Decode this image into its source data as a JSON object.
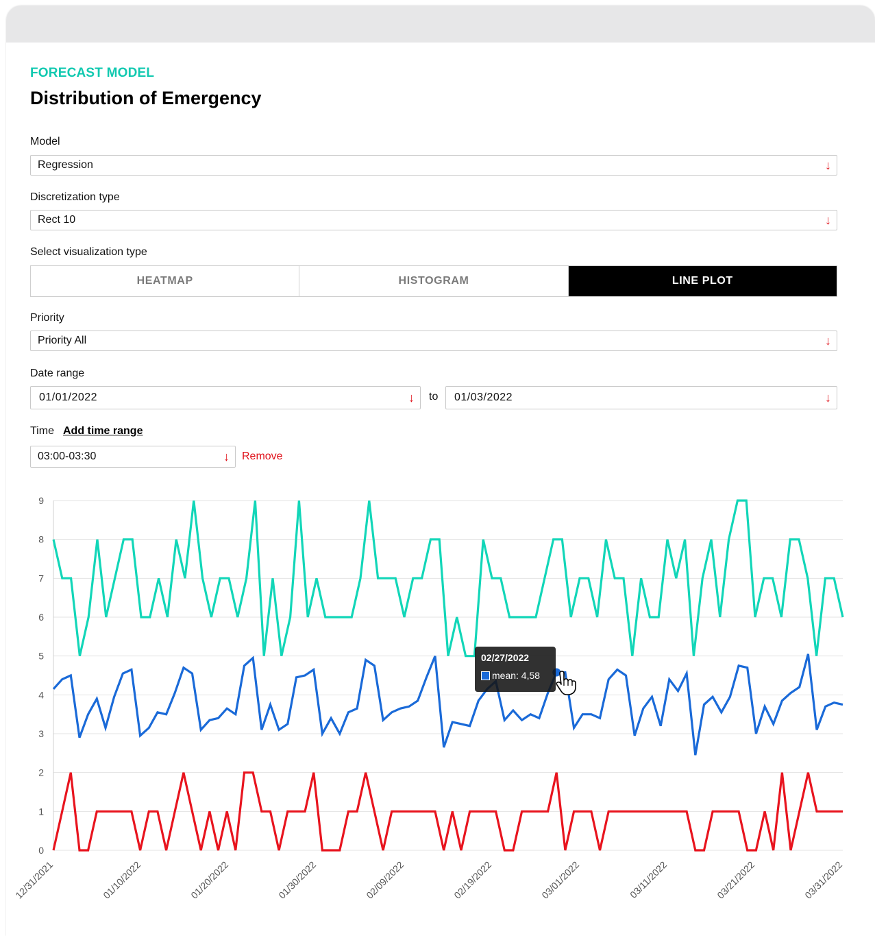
{
  "header": {
    "eyebrow": "FORECAST MODEL",
    "title": "Distribution of Emergency"
  },
  "form": {
    "model_label": "Model",
    "model_value": "Regression",
    "discretization_label": "Discretization type",
    "discretization_value": "Rect 10",
    "viz_label": "Select visualization type",
    "viz_options": [
      "HEATMAP",
      "HISTOGRAM",
      "LINE PLOT"
    ],
    "viz_selected": "LINE PLOT",
    "priority_label": "Priority",
    "priority_value": "Priority All",
    "date_label": "Date range",
    "date_from": "01/01/2022",
    "date_to_label": "to",
    "date_to": "01/03/2022",
    "time_label": "Time",
    "add_time_range": "Add time range",
    "time_value": "03:00-03:30",
    "remove_label": "Remove"
  },
  "icons": {
    "dropdown": "arrow-down-icon",
    "cursor": "hand-pointer-icon"
  },
  "colors": {
    "accent": "#12c9b0",
    "danger": "#e0121b",
    "series_top": "#12d6b8",
    "series_mean": "#1a6ad8",
    "series_bottom": "#e8141e"
  },
  "tooltip": {
    "date": "02/27/2022",
    "series": "mean",
    "value_text": "mean: 4,58"
  },
  "chart_data": {
    "type": "line",
    "ylim": [
      0,
      9
    ],
    "y_ticks": [
      0,
      1,
      2,
      3,
      4,
      5,
      6,
      7,
      8,
      9
    ],
    "grid": true,
    "x_tick_labels": [
      "12/31/2021",
      "01/10/2022",
      "01/20/2022",
      "01/30/2022",
      "02/09/2022",
      "02/19/2022",
      "03/01/2022",
      "03/11/2022",
      "03/21/2022",
      "03/31/2022"
    ],
    "x_start": "12/31/2021",
    "x_end": "03/31/2022",
    "series": [
      {
        "color": "#12d6b8",
        "values": [
          8,
          7,
          7,
          5,
          6,
          8,
          6,
          7,
          8,
          8,
          6,
          6,
          7,
          6,
          8,
          7,
          9,
          7,
          6,
          7,
          7,
          6,
          7,
          9,
          5,
          7,
          5,
          6,
          9,
          6,
          7,
          6,
          6,
          6,
          6,
          7,
          9,
          7,
          7,
          7,
          6,
          7,
          7,
          8,
          8,
          5,
          6,
          5,
          5,
          8,
          7,
          7,
          6,
          6,
          6,
          6,
          7,
          8,
          8,
          6,
          7,
          7,
          6,
          8,
          7,
          7,
          5,
          7,
          6,
          6,
          8,
          7,
          8,
          5,
          7,
          8,
          6,
          8,
          9,
          9,
          6,
          7,
          7,
          6,
          8,
          8,
          7,
          5,
          7,
          7,
          6
        ]
      },
      {
        "color": "#1a6ad8",
        "values": [
          4.15,
          4.4,
          4.5,
          2.9,
          3.5,
          3.9,
          3.15,
          3.95,
          4.55,
          4.65,
          2.95,
          3.15,
          3.55,
          3.5,
          4.05,
          4.7,
          4.55,
          3.1,
          3.35,
          3.4,
          3.65,
          3.5,
          4.75,
          4.95,
          3.1,
          3.75,
          3.1,
          3.25,
          4.45,
          4.5,
          4.65,
          3.0,
          3.4,
          3.0,
          3.55,
          3.65,
          4.9,
          4.75,
          3.35,
          3.55,
          3.65,
          3.7,
          3.85,
          4.45,
          5.0,
          2.65,
          3.3,
          3.25,
          3.2,
          3.85,
          4.15,
          4.35,
          3.35,
          3.6,
          3.35,
          3.5,
          3.4,
          4.05,
          4.58,
          4.58,
          3.15,
          3.5,
          3.5,
          3.4,
          4.4,
          4.65,
          4.5,
          2.95,
          3.65,
          3.95,
          3.2,
          4.4,
          4.1,
          4.55,
          2.45,
          3.75,
          3.95,
          3.55,
          3.95,
          4.75,
          4.7,
          3.0,
          3.7,
          3.25,
          3.85,
          4.05,
          4.2,
          5.05,
          3.1,
          3.7,
          3.8,
          3.75
        ]
      },
      {
        "color": "#e8141e",
        "values": [
          0,
          1,
          2,
          0,
          0,
          1,
          1,
          1,
          1,
          1,
          0,
          1,
          1,
          0,
          1,
          2,
          1,
          0,
          1,
          0,
          1,
          0,
          2,
          2,
          1,
          1,
          0,
          1,
          1,
          1,
          2,
          0,
          0,
          0,
          1,
          1,
          2,
          1,
          0,
          1,
          1,
          1,
          1,
          1,
          1,
          0,
          1,
          0,
          1,
          1,
          1,
          1,
          0,
          0,
          1,
          1,
          1,
          1,
          2,
          0,
          1,
          1,
          1,
          0,
          1,
          1,
          1,
          1,
          1,
          1,
          1,
          1,
          1,
          1,
          0,
          0,
          1,
          1,
          1,
          1,
          0,
          0,
          1,
          0,
          2,
          0,
          1,
          2,
          1,
          1,
          1,
          1
        ]
      }
    ]
  }
}
